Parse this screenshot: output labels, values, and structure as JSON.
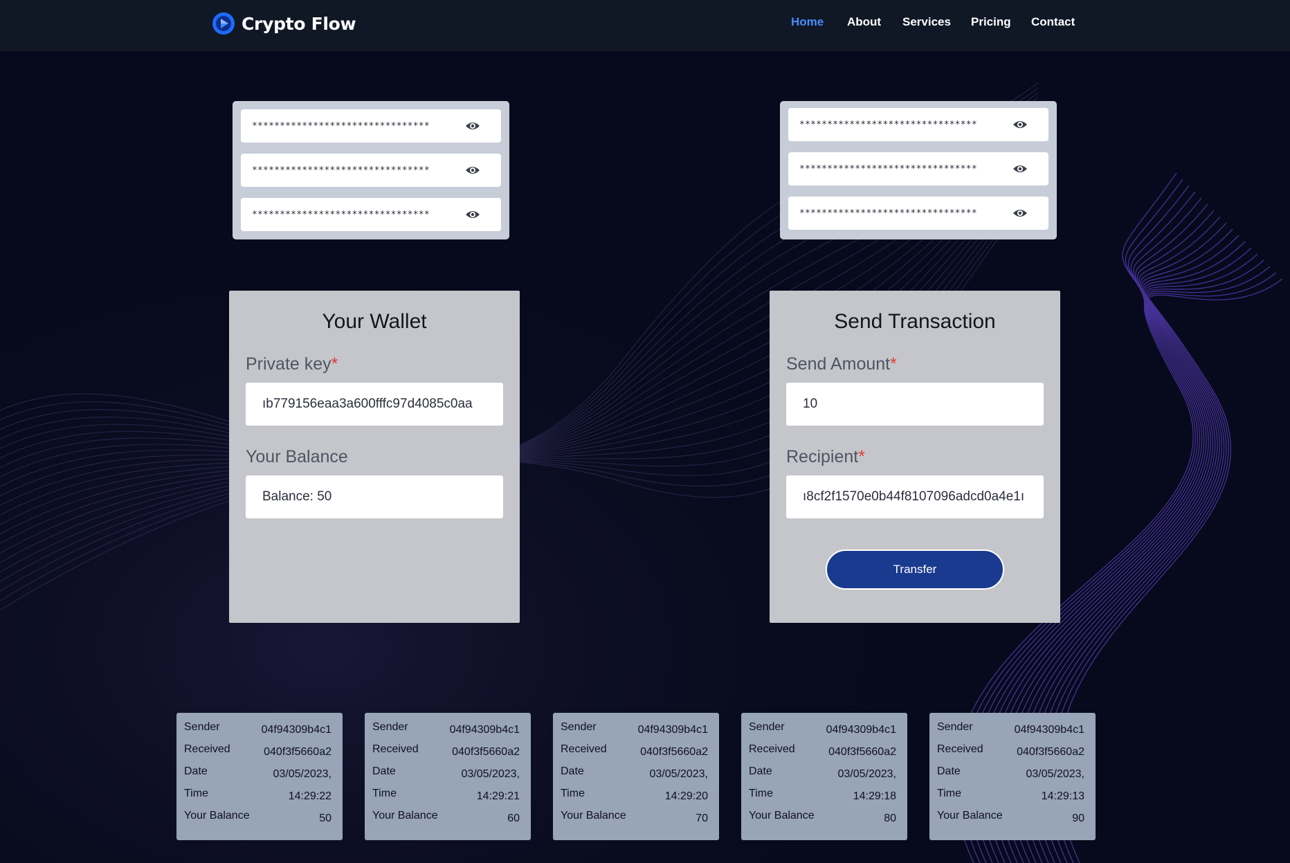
{
  "app": {
    "brand": "Crypto Flow",
    "accent_color": "#4a8cff",
    "button_color": "#1a3a8f"
  },
  "nav": {
    "items": [
      {
        "label": "Home",
        "active": true
      },
      {
        "label": "About",
        "active": false
      },
      {
        "label": "Services",
        "active": false
      },
      {
        "label": "Pricing",
        "active": false
      },
      {
        "label": "Contact",
        "active": false
      }
    ]
  },
  "key_panels": {
    "left": [
      {
        "masked": "********************************",
        "icon": "eye-icon"
      },
      {
        "masked": "********************************",
        "icon": "eye-icon"
      },
      {
        "masked": "********************************",
        "icon": "eye-icon"
      }
    ],
    "right": [
      {
        "masked": "********************************",
        "icon": "eye-icon"
      },
      {
        "masked": "********************************",
        "icon": "eye-icon"
      },
      {
        "masked": "********************************",
        "icon": "eye-icon"
      }
    ]
  },
  "wallet": {
    "title": "Your Wallet",
    "private_key_label": "Private key",
    "required_mark": "*",
    "private_key_value": "ıb779156eaa3a600fffc97d4085c0aa",
    "balance_label": "Your Balance",
    "balance_value": "Balance: 50"
  },
  "send": {
    "title": "Send Transaction",
    "amount_label": "Send Amount",
    "required_mark": "*",
    "amount_value": "10",
    "recipient_label": "Recipient",
    "recipient_value": "ı8cf2f1570e0b44f8107096adcd0a4e1ı",
    "transfer_label": "Transfer"
  },
  "transactions": [
    {
      "sender_label": "Sender",
      "sender": "04f94309b4c1",
      "received_label": "Received",
      "received": "040f3f5660a2",
      "date_label": "Date",
      "date": "03/05/2023,",
      "time_label": "Time",
      "time": "14:29:22",
      "balance_label": "Your Balance",
      "balance": "50"
    },
    {
      "sender_label": "Sender",
      "sender": "04f94309b4c1",
      "received_label": "Received",
      "received": "040f3f5660a2",
      "date_label": "Date",
      "date": "03/05/2023,",
      "time_label": "Time",
      "time": "14:29:21",
      "balance_label": "Your Balance",
      "balance": "60"
    },
    {
      "sender_label": "Sender",
      "sender": "04f94309b4c1",
      "received_label": "Received",
      "received": "040f3f5660a2",
      "date_label": "Date",
      "date": "03/05/2023,",
      "time_label": "Time",
      "time": "14:29:20",
      "balance_label": "Your Balance",
      "balance": "70"
    },
    {
      "sender_label": "Sender",
      "sender": "04f94309b4c1",
      "received_label": "Received",
      "received": "040f3f5660a2",
      "date_label": "Date",
      "date": "03/05/2023,",
      "time_label": "Time",
      "time": "14:29:18",
      "balance_label": "Your Balance",
      "balance": "80"
    },
    {
      "sender_label": "Sender",
      "sender": "04f94309b4c1",
      "received_label": "Received",
      "received": "040f3f5660a2",
      "date_label": "Date",
      "date": "03/05/2023,",
      "time_label": "Time",
      "time": "14:29:13",
      "balance_label": "Your Balance",
      "balance": "90"
    }
  ]
}
